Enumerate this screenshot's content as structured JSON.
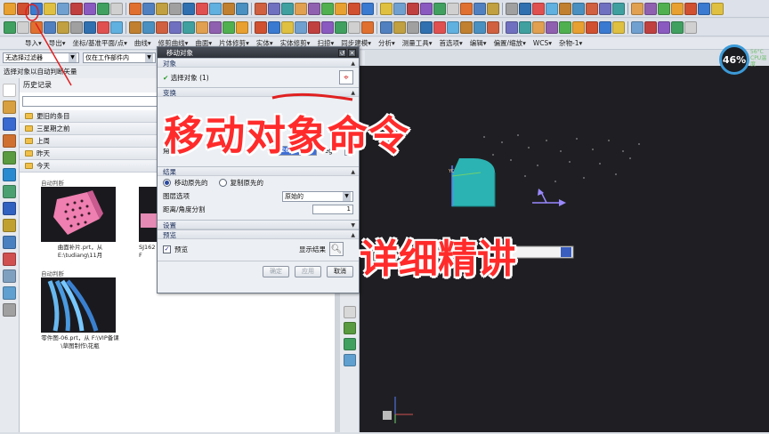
{
  "toolbar_colors": [
    "#e8a030",
    "#d05030",
    "#3a7ad0",
    "#e0c040",
    "#70a0d0",
    "#c04040",
    "#8a5ac0",
    "#40a060",
    "#d0d0d0",
    "#e07030",
    "#5080c0",
    "#c0a040",
    "#a0a0a0",
    "#3070b0",
    "#e05050",
    "#60b0e0",
    "#c08030",
    "#4a90c0",
    "#d06040",
    "#7070c0",
    "#40a0a0",
    "#e0a050",
    "#9060b0",
    "#50b050"
  ],
  "menu": {
    "items": [
      "导入▾",
      "导出▾",
      "坐标/基准平面/点▾",
      "曲线▾",
      "修剪曲线▾",
      "曲面▾",
      "片体修剪▾",
      "实体▾",
      "实体修剪▾",
      "扫掠▾",
      "同步建模▾",
      "分析▾",
      "测量工具▾",
      "首选项▾",
      "编辑▾",
      "偏置/缩放▾",
      "WCS▾",
      "杂物-1▾"
    ]
  },
  "filter": {
    "type_filter": "无选择过滤器",
    "scope": "仅在工作部件内"
  },
  "hint": "选择对象以自动判断矢量",
  "history": {
    "title": "历史记录",
    "groups": [
      "更旧的条目",
      "三星期之前",
      "上周",
      "昨天",
      "今天"
    ],
    "thumbs": [
      {
        "tag": "自动判断",
        "caption": "曲面补片.prt，从 E:\\tudiang\\11月"
      },
      {
        "tag": "自动判断",
        "caption": "SJ162 F"
      },
      {
        "tag": "自动判断",
        "caption": "零件图-06.prt，从 F:\\VIP备课\\草图制作\\花瓶"
      }
    ]
  },
  "dialog": {
    "title": "移动对象",
    "sec_object": "对象",
    "select_label": "选择对象 (1)",
    "sec_transform": "变换",
    "angle_label": "角度",
    "angle_value": "269",
    "angle_unit": "deg",
    "sec_result": "结果",
    "move_original": "移动原先的",
    "copy_original": "复制原先的",
    "layer_label": "图层选项",
    "layer_value": "原始的",
    "distance_label": "距离/角度分割",
    "distance_value": "1",
    "sec_settings": "设置",
    "sec_preview": "预览",
    "preview_label": "预览",
    "show_result": "显示结果",
    "ok": "确定",
    "apply": "应用",
    "cancel": "取消"
  },
  "overlay": {
    "title": "移动对象命令",
    "subtitle": "详细精讲"
  },
  "cpu": {
    "percent": "46%",
    "temp": "56°C",
    "label": "CPU温度"
  }
}
